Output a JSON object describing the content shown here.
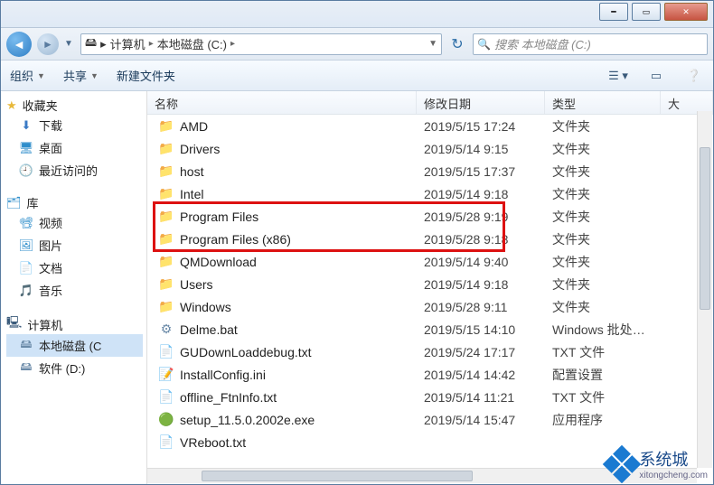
{
  "window": {
    "breadcrumb": {
      "computer": "计算机",
      "drive": "本地磁盘 (C:)"
    },
    "search_placeholder": "搜索 本地磁盘 (C:)"
  },
  "toolbar": {
    "organize": "组织",
    "share": "共享",
    "new_folder": "新建文件夹"
  },
  "columns": {
    "name": "名称",
    "modified": "修改日期",
    "type": "类型",
    "size": "大"
  },
  "sidebar": {
    "favorites": "收藏夹",
    "downloads": "下载",
    "desktop": "桌面",
    "recent": "最近访问的",
    "libraries": "库",
    "videos": "视频",
    "pictures": "图片",
    "documents": "文档",
    "music": "音乐",
    "computer": "计算机",
    "drive_c": "本地磁盘 (C",
    "drive_d": "软件 (D:)"
  },
  "files": [
    {
      "name": "AMD",
      "date": "2019/5/15 17:24",
      "type": "文件夹",
      "icon": "folder"
    },
    {
      "name": "Drivers",
      "date": "2019/5/14 9:15",
      "type": "文件夹",
      "icon": "folder"
    },
    {
      "name": "host",
      "date": "2019/5/15 17:37",
      "type": "文件夹",
      "icon": "folder"
    },
    {
      "name": "Intel",
      "date": "2019/5/14 9:18",
      "type": "文件夹",
      "icon": "folder"
    },
    {
      "name": "Program Files",
      "date": "2019/5/28 9:19",
      "type": "文件夹",
      "icon": "folder",
      "hl": true
    },
    {
      "name": "Program Files (x86)",
      "date": "2019/5/28 9:18",
      "type": "文件夹",
      "icon": "folder",
      "hl": true
    },
    {
      "name": "QMDownload",
      "date": "2019/5/14 9:40",
      "type": "文件夹",
      "icon": "folder"
    },
    {
      "name": "Users",
      "date": "2019/5/14 9:18",
      "type": "文件夹",
      "icon": "folder"
    },
    {
      "name": "Windows",
      "date": "2019/5/28 9:11",
      "type": "文件夹",
      "icon": "folder"
    },
    {
      "name": "Delme.bat",
      "date": "2019/5/15 14:10",
      "type": "Windows 批处理...",
      "icon": "bat"
    },
    {
      "name": "GUDownLoaddebug.txt",
      "date": "2019/5/24 17:17",
      "type": "TXT 文件",
      "icon": "txt"
    },
    {
      "name": "InstallConfig.ini",
      "date": "2019/5/14 14:42",
      "type": "配置设置",
      "icon": "ini"
    },
    {
      "name": "offline_FtnInfo.txt",
      "date": "2019/5/14 11:21",
      "type": "TXT 文件",
      "icon": "txt"
    },
    {
      "name": "setup_11.5.0.2002e.exe",
      "date": "2019/5/14 15:47",
      "type": "应用程序",
      "icon": "exe"
    },
    {
      "name": "VReboot.txt",
      "date": "",
      "type": "",
      "icon": "txt"
    }
  ],
  "watermark": {
    "brand": "系统城",
    "url": "xitongcheng.com"
  }
}
